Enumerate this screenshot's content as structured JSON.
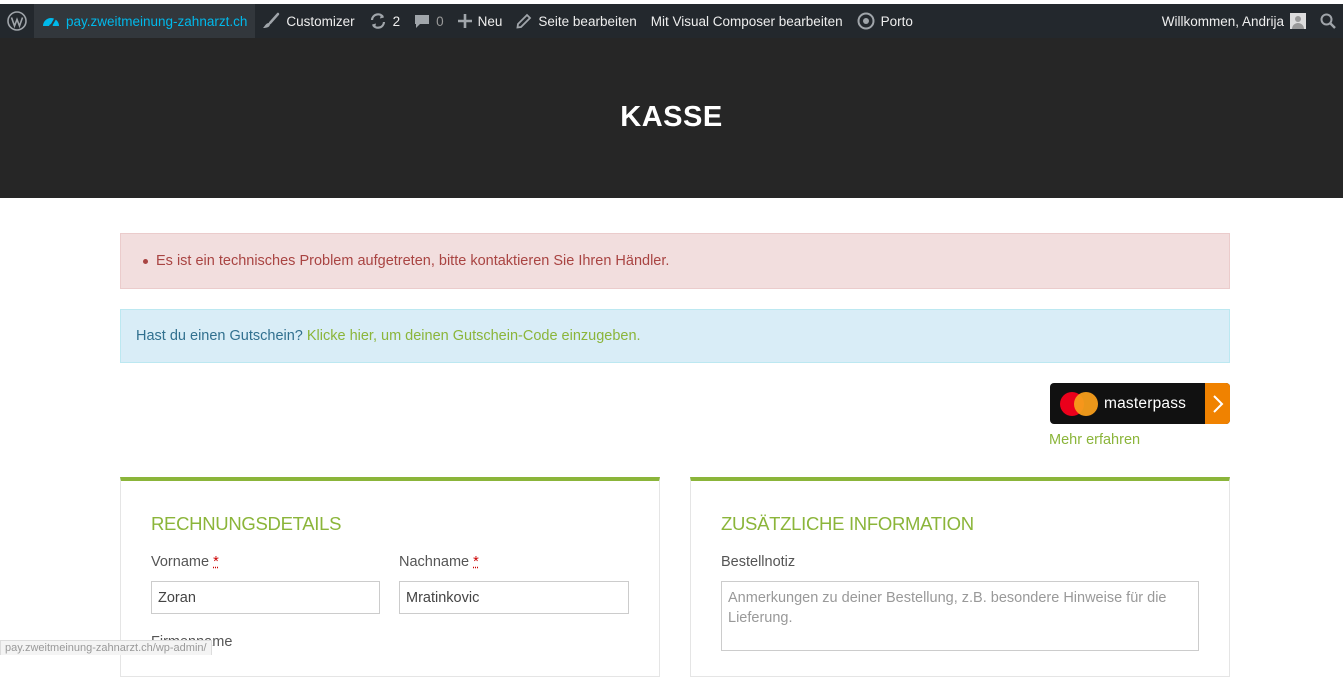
{
  "adminbar": {
    "site_name": "pay.zweitmeinung-zahnarzt.ch",
    "customizer_label": "Customizer",
    "updates_count": "2",
    "comments_count": "0",
    "new_label": "Neu",
    "edit_page_label": "Seite bearbeiten",
    "visual_composer_label": "Mit Visual Composer bearbeiten",
    "theme_label": "Porto",
    "welcome_text": "Willkommen, Andrija",
    "icons": [
      "wordpress-icon",
      "dashboard-icon",
      "brush-icon",
      "updates-icon",
      "comment-icon",
      "plus-icon",
      "pencil-icon",
      "porto-icon",
      "search-icon"
    ]
  },
  "header": {
    "title": "KASSE"
  },
  "notices": {
    "error_text": "Es ist ein technisches Problem aufgetreten, bitte kontaktieren Sie Ihren Händler.",
    "coupon_question": "Hast du einen Gutschein?",
    "coupon_link": "Klicke hier, um deinen Gutschein-Code einzugeben."
  },
  "masterpass": {
    "button_label": "masterpass",
    "learn_more": "Mehr erfahren"
  },
  "billing": {
    "title": "RECHNUNGSDETAILS",
    "first_name_label": "Vorname",
    "first_name_value": "Zoran",
    "last_name_label": "Nachname",
    "last_name_value": "Mratinkovic",
    "required_mark": "*",
    "company_label": "Firmenname"
  },
  "additional": {
    "title": "ZUSÄTZLICHE INFORMATION",
    "order_note_label": "Bestellnotiz",
    "order_note_placeholder": "Anmerkungen zu deiner Bestellung, z.B. besondere Hinweise für die Lieferung."
  },
  "statusbar": {
    "url": "pay.zweitmeinung-zahnarzt.ch/wp-admin/"
  },
  "colors": {
    "accent_green": "#8bb53a",
    "adminbar_bg": "#23282d",
    "header_bg": "#262626",
    "error_bg": "#f2dede",
    "info_bg": "#d9edf7",
    "masterpass_orange": "#f08200"
  }
}
